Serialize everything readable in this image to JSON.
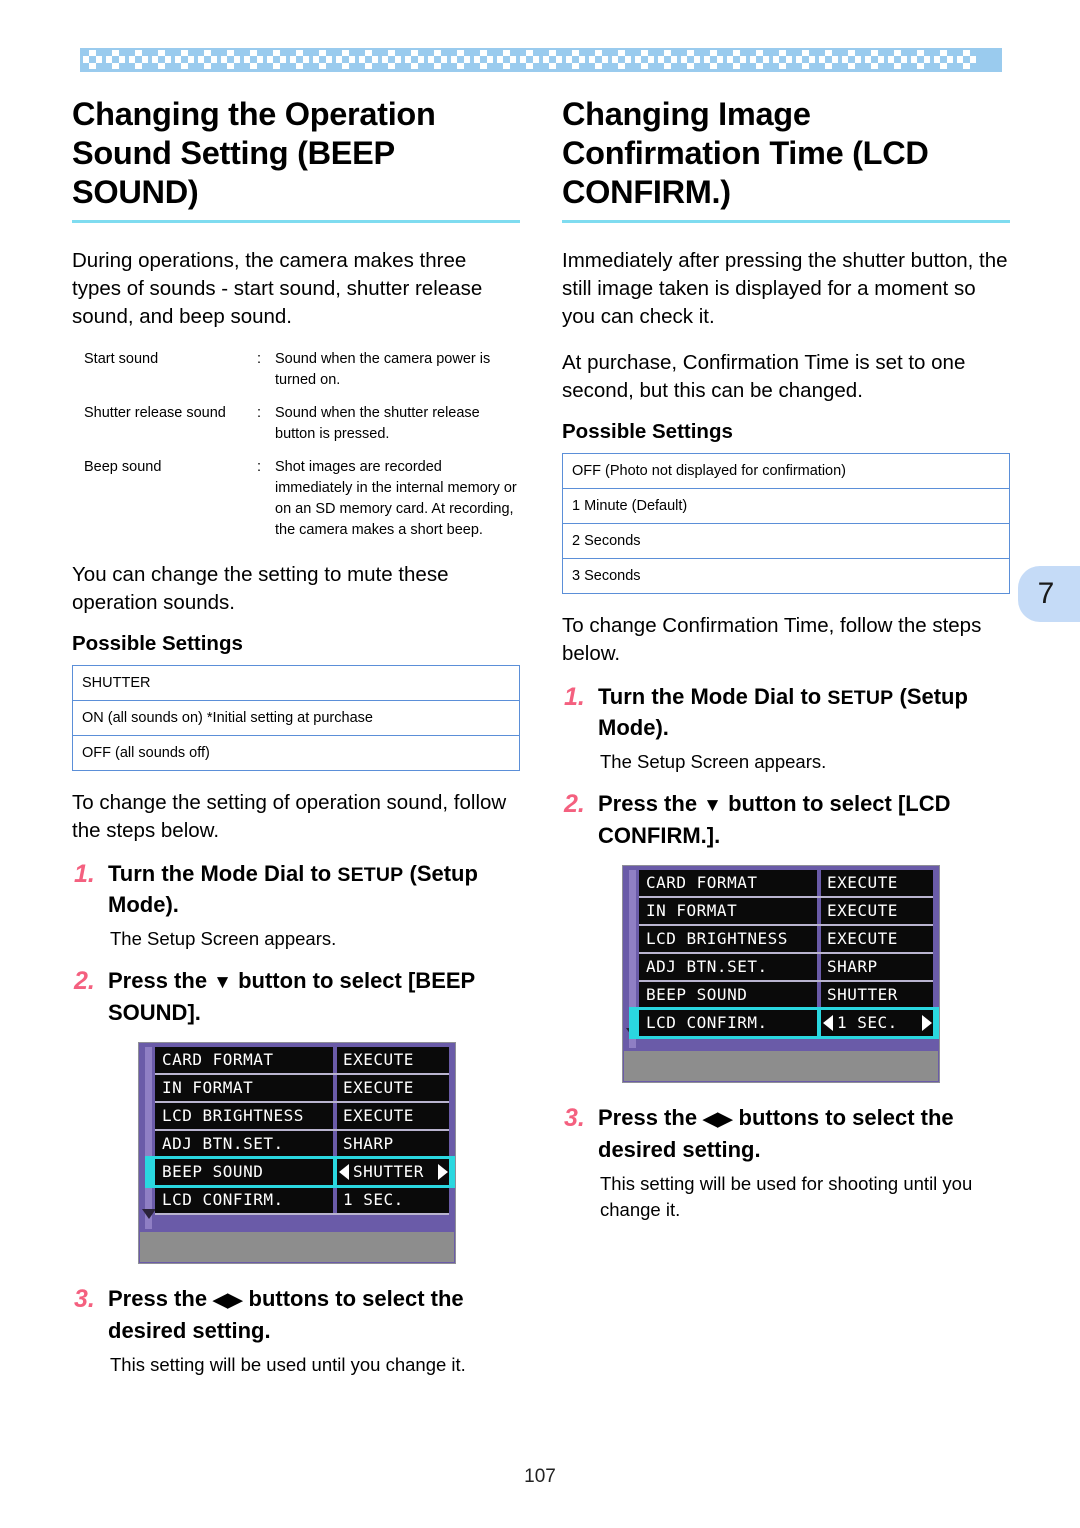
{
  "document": {
    "page_number": "107",
    "chapter_tab": "7",
    "accent_rule_color": "#7fdcf0",
    "step_number_color": "#f4607f",
    "table_border_color": "#5b8fd8",
    "band_color": "#9acbee",
    "tab_color": "#c5dbf7"
  },
  "left_column": {
    "title": "Changing the Operation Sound Setting (BEEP SOUND)",
    "intro": "During operations, the camera makes three types of sounds - start sound, shutter release sound, and beep sound.",
    "sound_types": [
      {
        "term": "Start sound",
        "colon": ":",
        "desc": "Sound when the camera power is turned on."
      },
      {
        "term": "Shutter release sound",
        "colon": ":",
        "desc": "Sound when the shutter release button is pressed."
      },
      {
        "term": "Beep sound",
        "colon": ":",
        "desc": "Shot images are recorded immediately in the internal memory or on an SD memory card. At recording, the camera makes a short beep."
      }
    ],
    "mute_note": "You can change the setting to mute these operation sounds.",
    "possible_settings_heading": "Possible Settings",
    "settings_rows": [
      "SHUTTER",
      "ON (all sounds on) *Initial setting at purchase",
      "OFF (all sounds off)"
    ],
    "steps_lead": "To change the setting of operation sound, follow the steps below.",
    "steps": [
      {
        "num": "1.",
        "text_before": "Turn the Mode Dial to ",
        "tag": "SETUP",
        "text_after": " (Setup Mode).",
        "note": "The Setup Screen appears."
      },
      {
        "num": "2.",
        "text_before": "Press the ",
        "glyph": "▼",
        "text_after": " button to select [BEEP SOUND].",
        "note": ""
      },
      {
        "num": "3.",
        "text_before": "Press the ",
        "glyph": "◀▶",
        "text_after": " buttons to select the desired setting.",
        "note": "This setting will be used until you change it."
      }
    ],
    "lcd_screen": {
      "rows": [
        {
          "label": "CARD FORMAT",
          "value": "EXECUTE",
          "selected": false
        },
        {
          "label": "IN FORMAT",
          "value": "EXECUTE",
          "selected": false
        },
        {
          "label": "LCD BRIGHTNESS",
          "value": "EXECUTE",
          "selected": false
        },
        {
          "label": "ADJ BTN.SET.",
          "value": "SHARP",
          "selected": false
        },
        {
          "label": "BEEP SOUND",
          "value": "SHUTTER",
          "selected": true
        },
        {
          "label": "LCD CONFIRM.",
          "value": "1 SEC.",
          "selected": false
        }
      ]
    }
  },
  "right_column": {
    "title": "Changing Image Confirmation Time (LCD CONFIRM.)",
    "intro1": "Immediately after pressing the shutter button, the still image taken is displayed for a moment so you can check it.",
    "intro2": "At purchase, Confirmation Time is set to one second, but this can be changed.",
    "possible_settings_heading": "Possible Settings",
    "settings_rows": [
      "OFF (Photo not displayed for confirmation)",
      "1 Minute (Default)",
      "2 Seconds",
      "3 Seconds"
    ],
    "steps_lead": "To change Confirmation Time, follow the steps below.",
    "steps": [
      {
        "num": "1.",
        "text_before": "Turn the Mode Dial to ",
        "tag": "SETUP",
        "text_after": " (Setup Mode).",
        "note": "The Setup Screen appears."
      },
      {
        "num": "2.",
        "text_before": "Press the ",
        "glyph": "▼",
        "text_after": " button to select [LCD CONFIRM.].",
        "note": ""
      },
      {
        "num": "3.",
        "text_before": "Press the ",
        "glyph": "◀▶",
        "text_after": " buttons to select the desired setting.",
        "note": "This setting will be used for shooting until you change it."
      }
    ],
    "lcd_screen": {
      "rows": [
        {
          "label": "CARD FORMAT",
          "value": "EXECUTE",
          "selected": false
        },
        {
          "label": "IN FORMAT",
          "value": "EXECUTE",
          "selected": false
        },
        {
          "label": "LCD BRIGHTNESS",
          "value": "EXECUTE",
          "selected": false
        },
        {
          "label": "ADJ BTN.SET.",
          "value": "SHARP",
          "selected": false
        },
        {
          "label": "BEEP SOUND",
          "value": "SHUTTER",
          "selected": false
        },
        {
          "label": "LCD CONFIRM.",
          "value": "1 SEC.",
          "selected": true
        }
      ]
    }
  }
}
